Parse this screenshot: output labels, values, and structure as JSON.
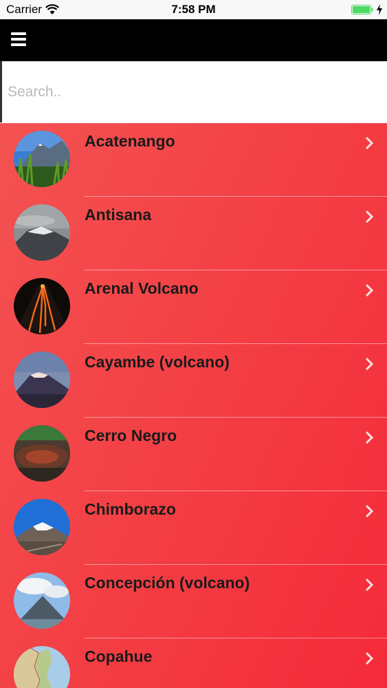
{
  "status_bar": {
    "carrier": "Carrier",
    "time": "7:58 PM"
  },
  "search": {
    "placeholder": "Search..",
    "value": ""
  },
  "volcanoes": [
    {
      "name": "Acatenango"
    },
    {
      "name": "Antisana"
    },
    {
      "name": "Arenal Volcano"
    },
    {
      "name": "Cayambe (volcano)"
    },
    {
      "name": "Cerro Negro"
    },
    {
      "name": "Chimborazo"
    },
    {
      "name": "Concepción (volcano)"
    },
    {
      "name": "Copahue"
    }
  ],
  "colors": {
    "list_gradient_start": "#f45252",
    "list_gradient_end": "#f52a3a",
    "nav_bar": "#000000",
    "battery": "#4cd964"
  }
}
